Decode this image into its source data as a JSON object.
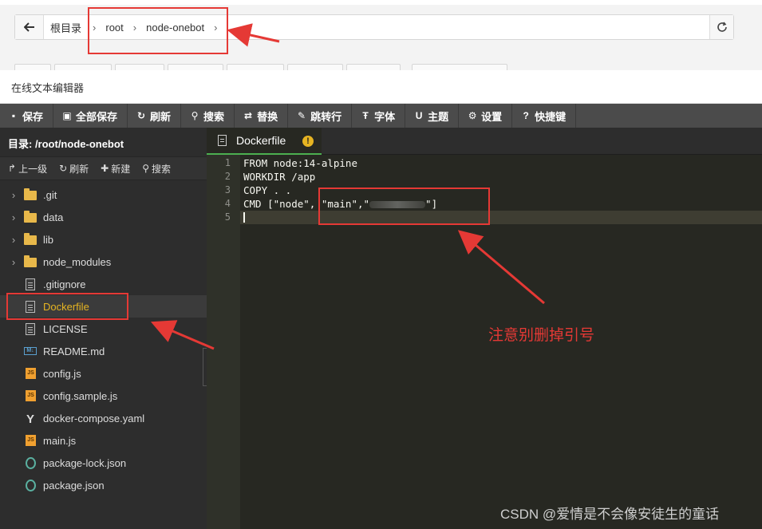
{
  "address_bar": {
    "crumbs": [
      "根目录",
      "root",
      "node-onebot"
    ],
    "separator": "›"
  },
  "editor_title": "在线文本编辑器",
  "menu": [
    {
      "icon": "save-icon",
      "label": "保存"
    },
    {
      "icon": "save-all-icon",
      "label": "全部保存"
    },
    {
      "icon": "refresh-icon",
      "label": "刷新"
    },
    {
      "icon": "search-icon",
      "label": "搜索"
    },
    {
      "icon": "replace-icon",
      "label": "替换"
    },
    {
      "icon": "pin-icon",
      "label": "跳转行"
    },
    {
      "icon": "font-icon",
      "label": "字体"
    },
    {
      "icon": "theme-icon",
      "label": "主题"
    },
    {
      "icon": "gear-icon",
      "label": "设置"
    },
    {
      "icon": "help-icon",
      "label": "快捷键"
    }
  ],
  "sidebar": {
    "dir_label": "目录: /root/node-onebot",
    "tools": [
      {
        "icon": "share-icon",
        "label": "上一级"
      },
      {
        "icon": "refresh-icon",
        "label": "刷新"
      },
      {
        "icon": "plus-icon",
        "label": "新建"
      },
      {
        "icon": "search-icon",
        "label": "搜索"
      }
    ],
    "tree": [
      {
        "name": ".git",
        "type": "folder"
      },
      {
        "name": "data",
        "type": "folder"
      },
      {
        "name": "lib",
        "type": "folder"
      },
      {
        "name": "node_modules",
        "type": "folder"
      },
      {
        "name": ".gitignore",
        "type": "file"
      },
      {
        "name": "Dockerfile",
        "type": "file",
        "selected": true
      },
      {
        "name": "LICENSE",
        "type": "file"
      },
      {
        "name": "README.md",
        "type": "md"
      },
      {
        "name": "config.js",
        "type": "js"
      },
      {
        "name": "config.sample.js",
        "type": "js"
      },
      {
        "name": "docker-compose.yaml",
        "type": "yaml"
      },
      {
        "name": "main.js",
        "type": "js"
      },
      {
        "name": "package-lock.json",
        "type": "json"
      },
      {
        "name": "package.json",
        "type": "json"
      }
    ]
  },
  "tab": {
    "label": "Dockerfile",
    "warning": "!"
  },
  "code_lines": [
    {
      "n": "1",
      "text": "FROM node:14-alpine"
    },
    {
      "n": "2",
      "text": "WORKDIR /app"
    },
    {
      "n": "3",
      "text": "COPY . ."
    },
    {
      "n": "4",
      "text_before": "CMD [\"node\", \"main\",\"",
      "text_after": "\"]"
    },
    {
      "n": "5",
      "text": ""
    }
  ],
  "annotation_note": "注意别删掉引号",
  "watermark": "CSDN @爱情是不会像安徒生的童话",
  "colors": {
    "annotation": "#e53935",
    "selected_file": "#e6b422",
    "tab_underline": "#4caf50"
  }
}
